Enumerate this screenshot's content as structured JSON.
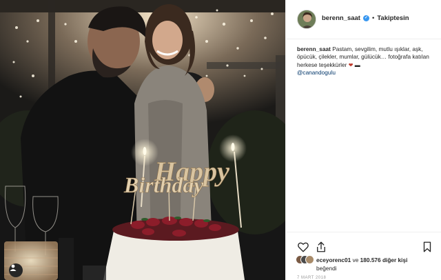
{
  "post": {
    "username": "berenn_saat",
    "verified_icon": "check-icon",
    "follow_status": "Takiptesin",
    "separator": "•",
    "caption_user": "berenn_saat",
    "caption_text": "Pastam, sevgilim, mutlu ışıklar, aşk, öpücük, çilekler, mumlar, gülücük… fotoğrafa katılan herkese teşekkürler",
    "caption_mention": "@canandogulu",
    "likes_user": "eceyorenc01",
    "likes_connector": "ve",
    "likes_count": "180.576 diğer kişi",
    "likes_suffix": "beğendi",
    "date": "7 MART 2018",
    "cake_text_line1": "Happy",
    "cake_text_line2": "Birthday"
  },
  "colors": {
    "verified": "#3897f0",
    "mention": "#003569",
    "text": "#262626"
  }
}
